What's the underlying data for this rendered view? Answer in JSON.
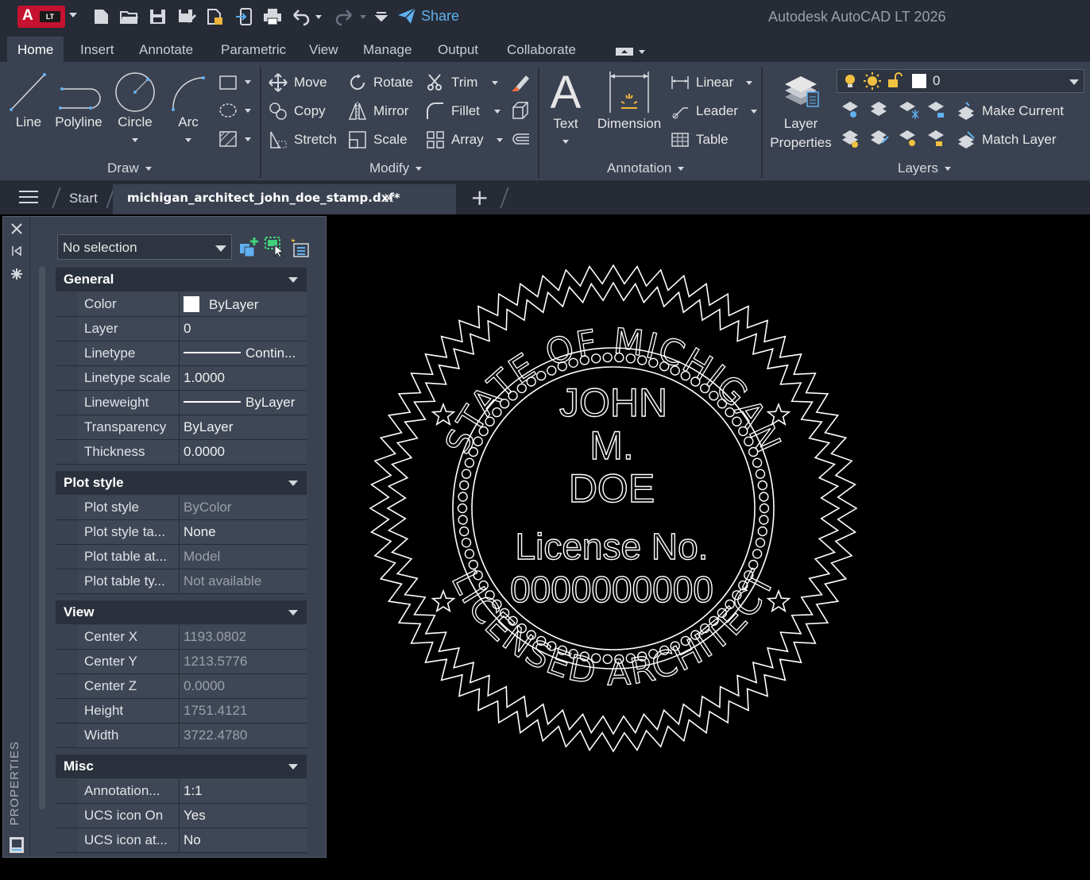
{
  "app": {
    "title": "Autodesk AutoCAD LT 2026",
    "logo_letter": "A",
    "logo_badge": "LT",
    "share_label": "Share"
  },
  "ribbon": {
    "tabs": [
      "Home",
      "Insert",
      "Annotate",
      "Parametric",
      "View",
      "Manage",
      "Output",
      "Collaborate"
    ],
    "active_tab": "Home",
    "draw": {
      "title": "Draw",
      "line": "Line",
      "polyline": "Polyline",
      "circle": "Circle",
      "arc": "Arc"
    },
    "modify": {
      "title": "Modify",
      "move": "Move",
      "rotate": "Rotate",
      "trim": "Trim",
      "copy": "Copy",
      "mirror": "Mirror",
      "fillet": "Fillet",
      "stretch": "Stretch",
      "scale": "Scale",
      "array": "Array"
    },
    "annotation": {
      "title": "Annotation",
      "text": "Text",
      "dimension": "Dimension",
      "linear": "Linear",
      "leader": "Leader",
      "table": "Table"
    },
    "layers": {
      "title": "Layers",
      "layer_properties_1": "Layer",
      "layer_properties_2": "Properties",
      "current_layer": "0",
      "make_current": "Make Current",
      "match_layer": "Match Layer"
    }
  },
  "filetabs": {
    "start": "Start",
    "active_file": "michigan_architect_john_doe_stamp.dxf*"
  },
  "properties": {
    "palette_title": "PROPERTIES",
    "selection": "No selection",
    "sections": {
      "general": {
        "title": "General",
        "rows": [
          {
            "name": "Color",
            "value": "ByLayer"
          },
          {
            "name": "Layer",
            "value": "0"
          },
          {
            "name": "Linetype",
            "value": "Contin..."
          },
          {
            "name": "Linetype scale",
            "value": "1.0000"
          },
          {
            "name": "Lineweight",
            "value": "ByLayer"
          },
          {
            "name": "Transparency",
            "value": "ByLayer"
          },
          {
            "name": "Thickness",
            "value": "0.0000"
          }
        ]
      },
      "plot_style": {
        "title": "Plot style",
        "rows": [
          {
            "name": "Plot style",
            "value": "ByColor"
          },
          {
            "name": "Plot style ta...",
            "value": "None"
          },
          {
            "name": "Plot table at...",
            "value": "Model"
          },
          {
            "name": "Plot table ty...",
            "value": "Not available"
          }
        ]
      },
      "view": {
        "title": "View",
        "rows": [
          {
            "name": "Center X",
            "value": "1193.0802"
          },
          {
            "name": "Center Y",
            "value": "1213.5776"
          },
          {
            "name": "Center Z",
            "value": "0.0000"
          },
          {
            "name": "Height",
            "value": "1751.4121"
          },
          {
            "name": "Width",
            "value": "3722.4780"
          }
        ]
      },
      "misc": {
        "title": "Misc",
        "rows": [
          {
            "name": "Annotation...",
            "value": "1:1"
          },
          {
            "name": "UCS icon On",
            "value": "Yes"
          },
          {
            "name": "UCS icon at...",
            "value": "No"
          }
        ]
      }
    }
  },
  "drawing": {
    "top_arc_text": "STATE OF MICHIGAN",
    "bottom_arc_text": "LICENSED ARCHITECT",
    "first_name": "JOHN",
    "middle_initial": "M.",
    "last_name": "DOE",
    "license_label": "License No.",
    "license_number": "0000000000"
  },
  "colors": {
    "chrome_dark": "#262b36",
    "ribbon": "#3a4150",
    "canvas": "#000000",
    "accent_share": "#5fb1f0",
    "logo_red": "#c41230"
  }
}
